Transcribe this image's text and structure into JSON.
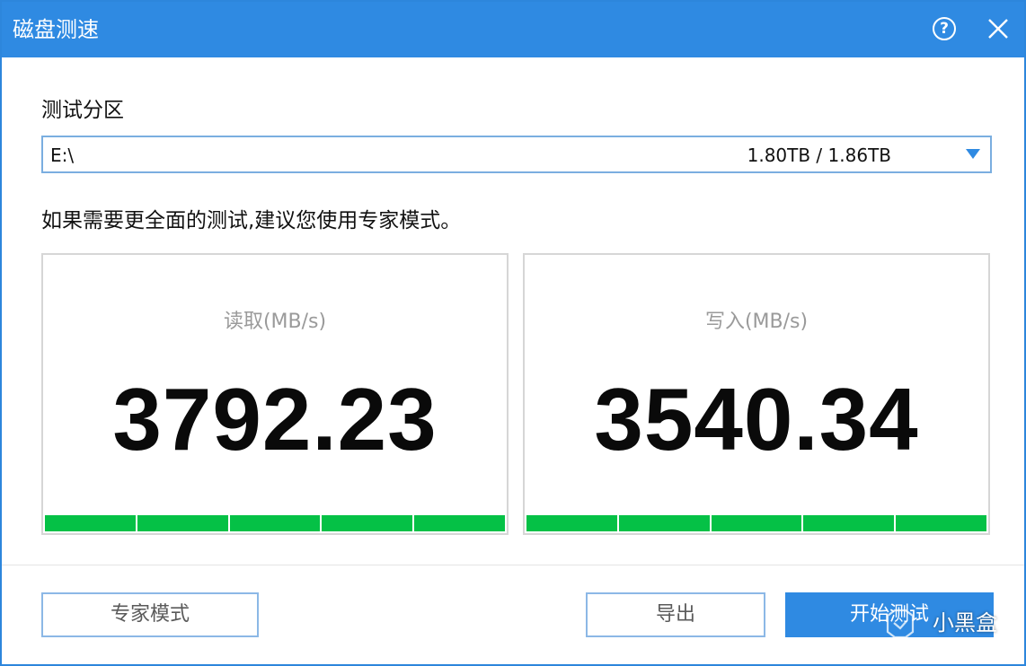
{
  "window": {
    "title": "磁盘测速"
  },
  "partition": {
    "label": "测试分区",
    "selected": "E:\\",
    "capacity": "1.80TB / 1.86TB"
  },
  "hint": "如果需要更全面的测试,建议您使用专家模式。",
  "read": {
    "label": "读取(MB/s)",
    "value": "3792.23",
    "progress": 1.0
  },
  "write": {
    "label": "写入(MB/s)",
    "value": "3540.34",
    "progress": 1.0
  },
  "buttons": {
    "expert": "专家模式",
    "export": "导出",
    "start": "开始测试"
  },
  "watermark": {
    "text": "小黑盒"
  },
  "colors": {
    "accent": "#2f8ae2",
    "progress": "#05c146"
  },
  "icons": [
    "help-icon",
    "close-icon",
    "chevron-down-icon",
    "watermark-logo-icon"
  ]
}
